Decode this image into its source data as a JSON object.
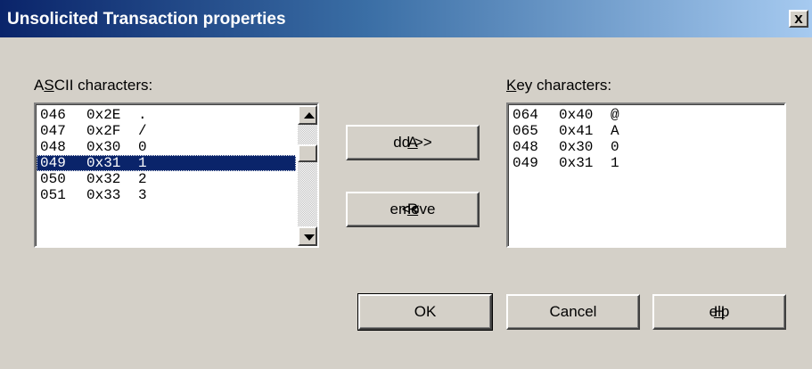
{
  "window": {
    "title": "Unsolicited Transaction properties",
    "close_label": "x"
  },
  "ascii_list": {
    "label_a": "A",
    "label_s": "S",
    "label_rest": "CII characters:",
    "rows": [
      {
        "dec": "046",
        "hex": "0x2E",
        "char": "."
      },
      {
        "dec": "047",
        "hex": "0x2F",
        "char": "/"
      },
      {
        "dec": "048",
        "hex": "0x30",
        "char": "0"
      },
      {
        "dec": "049",
        "hex": "0x31",
        "char": "1"
      },
      {
        "dec": "050",
        "hex": "0x32",
        "char": "2"
      },
      {
        "dec": "051",
        "hex": "0x33",
        "char": "3"
      }
    ],
    "selected_index": 3
  },
  "key_list": {
    "label_k": "K",
    "label_rest": "ey characters:",
    "rows": [
      {
        "dec": "064",
        "hex": "0x40",
        "char": "@"
      },
      {
        "dec": "065",
        "hex": "0x41",
        "char": "A"
      },
      {
        "dec": "048",
        "hex": "0x30",
        "char": "0"
      },
      {
        "dec": "049",
        "hex": "0x31",
        "char": "1"
      }
    ]
  },
  "buttons": {
    "add_mnemonic": "A",
    "add_rest": "dd >>",
    "remove_prefix": "<< ",
    "remove_mnemonic": "R",
    "remove_rest": "emove",
    "ok": "OK",
    "cancel": "Cancel",
    "help_mnemonic": "H",
    "help_rest": "elp"
  },
  "colors": {
    "face": "#d4d0c8",
    "selection": "#0a246a",
    "title_start": "#0a246a",
    "title_end": "#a6caf0"
  }
}
